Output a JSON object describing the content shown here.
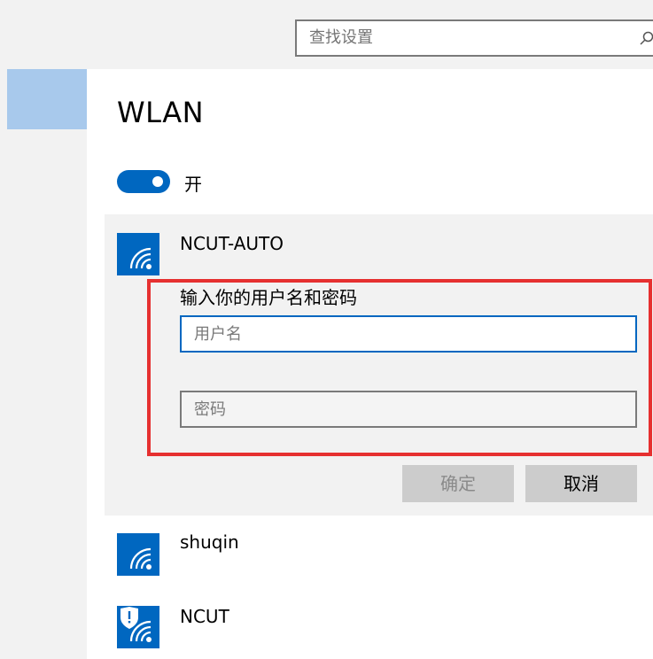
{
  "search": {
    "placeholder": "查找设置",
    "icon": "search-icon"
  },
  "page": {
    "title": "WLAN"
  },
  "wifi_toggle": {
    "state_label": "开",
    "on": true,
    "accent": "#0067c0"
  },
  "networks": [
    {
      "name": "NCUT-AUTO",
      "icon": "wifi-signal-icon",
      "expanded": true,
      "auth": {
        "prompt": "输入你的用户名和密码",
        "username_placeholder": "用户名",
        "password_placeholder": "密码",
        "confirm_label": "确定",
        "cancel_label": "取消"
      }
    },
    {
      "name": "shuqin",
      "icon": "wifi-signal-icon"
    },
    {
      "name": "NCUT",
      "icon": "wifi-secured-icon"
    }
  ],
  "colors": {
    "accent": "#0067c0",
    "highlight_frame": "#e63030",
    "sidebar_selected": "#a8c9ec"
  }
}
